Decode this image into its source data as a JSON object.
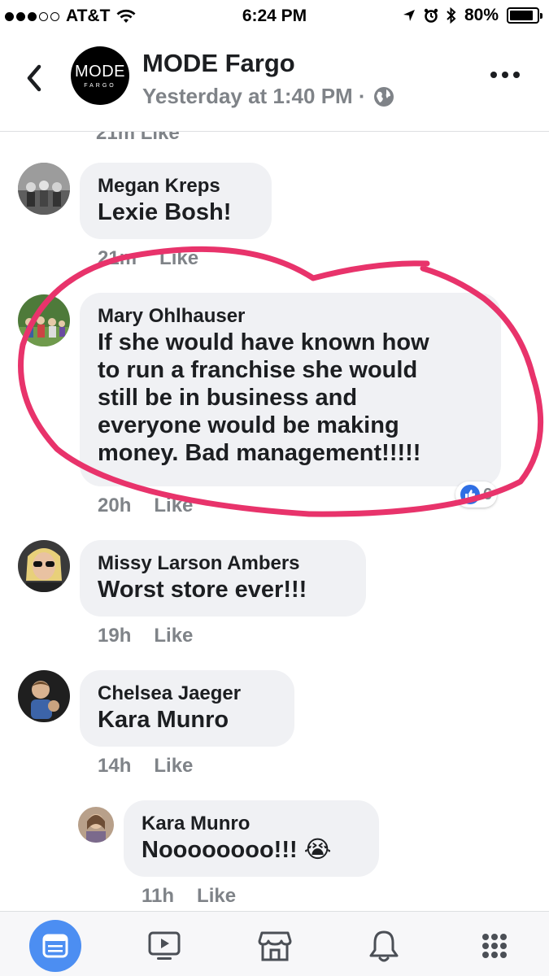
{
  "status_bar": {
    "carrier": "AT&T",
    "time": "6:24 PM",
    "battery": "80%"
  },
  "header": {
    "logo_line1": "MODE",
    "logo_line2": "FARGO",
    "page_name": "MODE Fargo",
    "timestamp": "Yesterday at 1:40 PM ·"
  },
  "feed": {
    "clipped_meta": "21m  Like",
    "comments": [
      {
        "author": "Megan Kreps",
        "text": "Lexie Bosh!",
        "time": "21m",
        "like": "Like"
      },
      {
        "author": "Mary Ohlhauser",
        "text_lines": [
          "If she would have known how",
          "to run a franchise she would",
          "still be in business and",
          "everyone would be making",
          "money. Bad management!!!!!"
        ],
        "time": "20h",
        "like": "Like",
        "reaction_count": "6"
      },
      {
        "author": "Missy Larson Ambers",
        "text": "Worst store ever!!!",
        "time": "19h",
        "like": "Like"
      },
      {
        "author": "Chelsea Jaeger",
        "text": "Kara Munro",
        "time": "14h",
        "like": "Like"
      },
      {
        "author": "Kara Munro",
        "text": "Noooooooo!!! 😭",
        "time": "11h",
        "like": "Like"
      }
    ]
  },
  "annotation_color": "#e8336b",
  "tabs": [
    {
      "name": "news-feed-icon",
      "active": true
    },
    {
      "name": "video-icon",
      "active": false
    },
    {
      "name": "marketplace-icon",
      "active": false
    },
    {
      "name": "notifications-icon",
      "active": false
    },
    {
      "name": "menu-grid-icon",
      "active": false
    }
  ]
}
